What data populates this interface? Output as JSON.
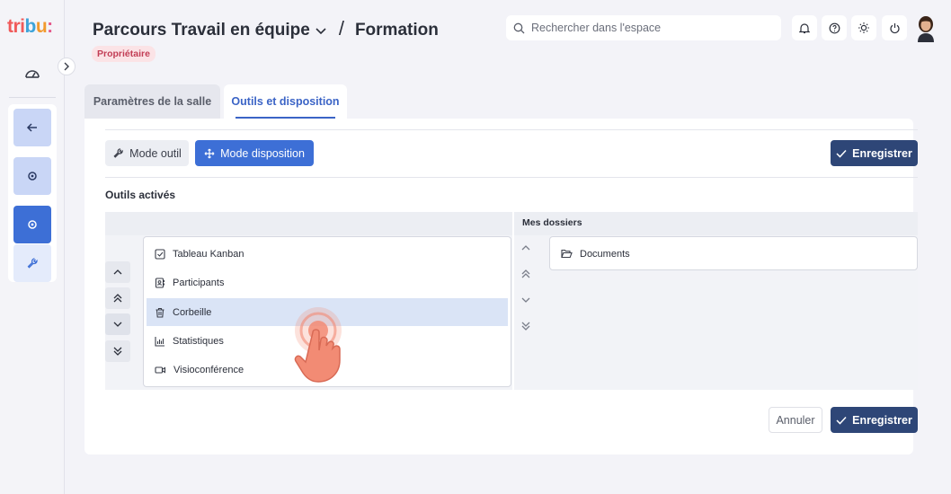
{
  "logo": {
    "parts": [
      "tri",
      "b",
      "u",
      ":"
    ]
  },
  "header": {
    "space_title": "Parcours Travail en équipe",
    "separator": "/",
    "room_title": "Formation",
    "role_badge": "Propriétaire",
    "search_placeholder": "Rechercher dans l'espace"
  },
  "tabs": [
    {
      "label": "Paramètres de la salle",
      "active": false
    },
    {
      "label": "Outils et disposition",
      "active": true
    }
  ],
  "toolbar": {
    "mode_tool_label": "Mode outil",
    "mode_layout_label": "Mode disposition",
    "save_label": "Enregistrer"
  },
  "activated": {
    "label": "Outils activés",
    "items": [
      {
        "label": "Tableau Kanban",
        "icon": "checkbox-icon",
        "selected": false
      },
      {
        "label": "Participants",
        "icon": "contact-card-icon",
        "selected": false
      },
      {
        "label": "Corbeille",
        "icon": "trash-icon",
        "selected": true
      },
      {
        "label": "Statistiques",
        "icon": "bar-chart-icon",
        "selected": false
      },
      {
        "label": "Visioconférence",
        "icon": "video-icon",
        "selected": false
      }
    ]
  },
  "folders": {
    "label": "Mes dossiers",
    "items": [
      {
        "label": "Documents",
        "icon": "folder-open-icon"
      }
    ]
  },
  "footer": {
    "cancel_label": "Annuler",
    "save_label": "Enregistrer"
  },
  "colors": {
    "accent": "#3d6fd6",
    "navy": "#2e4677",
    "badge_bg": "#fbe3e6",
    "badge_text": "#c23d55",
    "selected_row": "#dae4f6",
    "cursor": "#f28b74"
  }
}
